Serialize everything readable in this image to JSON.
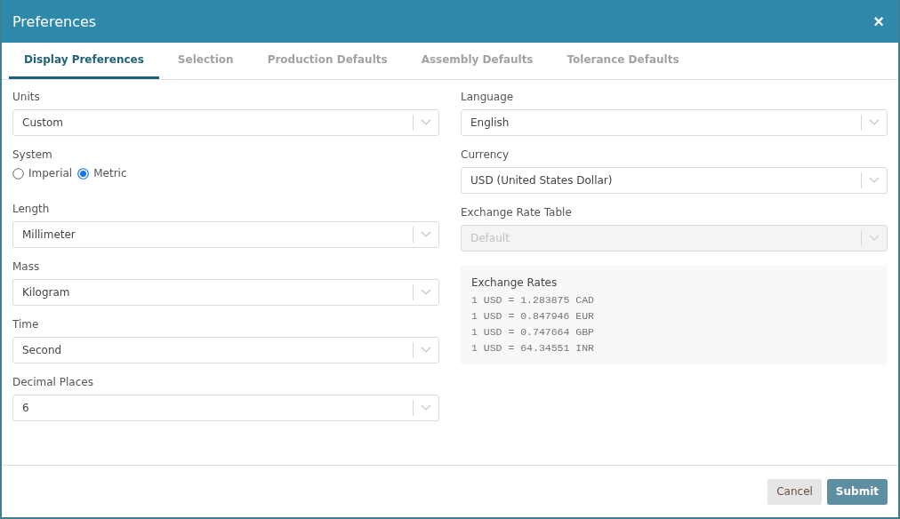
{
  "window": {
    "title": "Preferences",
    "close": "×"
  },
  "tabs": [
    {
      "label": "Display Preferences",
      "selected": true
    },
    {
      "label": "Selection",
      "selected": false
    },
    {
      "label": "Production Defaults",
      "selected": false
    },
    {
      "label": "Assembly Defaults",
      "selected": false
    },
    {
      "label": "Tolerance Defaults",
      "selected": false
    }
  ],
  "left_fields": [
    {
      "kind": "select",
      "label": "Units",
      "value": "Custom",
      "disabled": false
    },
    {
      "kind": "radio",
      "label": "System",
      "options": [
        {
          "label": "Imperial",
          "selected": false
        },
        {
          "label": "Metric",
          "selected": true
        }
      ]
    },
    {
      "kind": "select",
      "label": "Length",
      "value": "Millimeter",
      "disabled": false
    },
    {
      "kind": "select",
      "label": "Mass",
      "value": "Kilogram",
      "disabled": false
    },
    {
      "kind": "select",
      "label": "Time",
      "value": "Second",
      "disabled": false
    },
    {
      "kind": "select",
      "label": "Decimal Places",
      "value": "6",
      "disabled": false
    }
  ],
  "right_fields": [
    {
      "kind": "select",
      "label": "Language",
      "value": "English",
      "disabled": false
    },
    {
      "kind": "select",
      "label": "Currency",
      "value": "USD (United States Dollar)",
      "disabled": false
    },
    {
      "kind": "select",
      "label": "Exchange Rate Table",
      "value": "Default",
      "disabled": true
    }
  ],
  "exchange_rates": {
    "title": "Exchange Rates",
    "lines": [
      "1 USD = 1.283875 CAD",
      "1 USD = 0.847946 EUR",
      "1 USD = 0.747664 GBP",
      "1 USD = 64.34551 INR"
    ]
  },
  "buttons": [
    {
      "label": "Cancel",
      "kind": "secondary"
    },
    {
      "label": "Submit",
      "kind": "primary"
    }
  ]
}
